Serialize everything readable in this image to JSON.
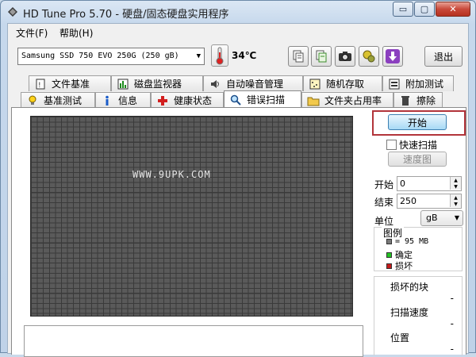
{
  "window": {
    "title": "HD Tune Pro 5.70 - 硬盘/固态硬盘实用程序",
    "minimize": "▭",
    "maximize": "▢",
    "close": "✕"
  },
  "menu": {
    "file": "文件(F)",
    "help": "帮助(H)"
  },
  "toolbar": {
    "drive": "Samsung SSD 750 EVO 250G (250 gB)",
    "temperature": "34℃",
    "exit_label": "退出",
    "icons": [
      "copy-info-icon",
      "copy-screen-icon",
      "camera-icon",
      "options-icon",
      "save-icon"
    ]
  },
  "tabs_top": [
    {
      "label": "文件基准",
      "icon": "file-benchmark-icon"
    },
    {
      "label": "磁盘监视器",
      "icon": "disk-monitor-icon"
    },
    {
      "label": "自动噪音管理",
      "icon": "speaker-icon"
    },
    {
      "label": "随机存取",
      "icon": "random-access-icon"
    },
    {
      "label": "附加测试",
      "icon": "extra-tests-icon"
    }
  ],
  "tabs_bottom": [
    {
      "label": "基准测试",
      "icon": "lightbulb-icon",
      "active": false
    },
    {
      "label": "信息",
      "icon": "info-icon",
      "active": false
    },
    {
      "label": "健康状态",
      "icon": "health-cross-icon",
      "active": false
    },
    {
      "label": "错误扫描",
      "icon": "magnifier-icon",
      "active": true
    },
    {
      "label": "文件夹占用率",
      "icon": "folder-icon",
      "active": false
    },
    {
      "label": "擦除",
      "icon": "trash-icon",
      "active": false
    }
  ],
  "scan": {
    "watermark": "WWW.9UPK.COM",
    "start_label": "开始",
    "quick_scan_label": "快速扫描",
    "quick_scan_checked": false,
    "map_label": "速度图",
    "start_field_label": "开始",
    "start_value": "0",
    "end_field_label": "结束",
    "end_value": "250",
    "unit_label": "单位",
    "unit_value": "gB"
  },
  "legend": {
    "title": "图例",
    "block_size": "= 95 MB",
    "ok_label": "确定",
    "bad_label": "损坏",
    "colors": {
      "block": "#7a7a7a",
      "ok": "#22c322",
      "bad": "#c41b1b"
    }
  },
  "stats": {
    "damaged_label": "损坏的块",
    "damaged_value": "-",
    "speed_label": "扫描速度",
    "speed_value": "-",
    "position_label": "位置",
    "position_value": "-"
  }
}
